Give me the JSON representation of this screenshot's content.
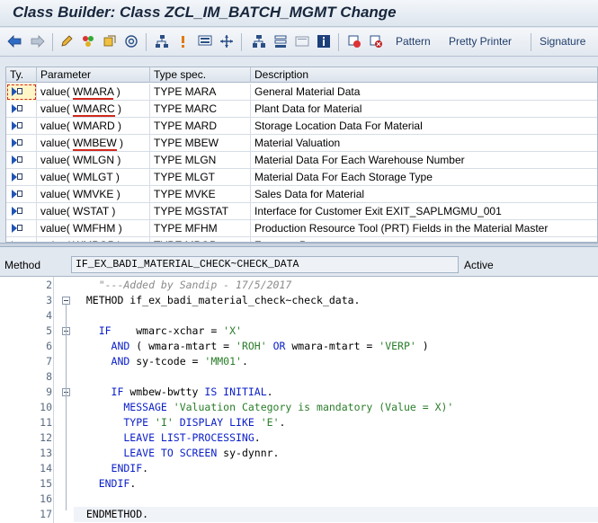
{
  "window": {
    "title": "Class Builder: Class ZCL_IM_BATCH_MGMT Change"
  },
  "toolbar": {
    "icons": [
      "back-arrow-icon",
      "forward-arrow-icon",
      "edit-pencil-icon",
      "activate-icon",
      "check-icon",
      "object-list-icon",
      "hierarchy-icon",
      "info-icon",
      "display-icon",
      "navigate-icon",
      "where-used-icon",
      "stack-icon",
      "layout-icon",
      "info-box-icon",
      "insert-icon",
      "cut-icon"
    ],
    "pattern_label": "Pattern",
    "pretty_printer_label": "Pretty Printer",
    "signature_label": "Signature"
  },
  "params": {
    "headers": {
      "type": "Ty.",
      "param": "Parameter",
      "spec": "Type spec.",
      "desc": "Description"
    },
    "rows": [
      {
        "kw": "value(",
        "name": "WMARA",
        "close": ")",
        "spec": "TYPE MARA",
        "desc": "General Material Data"
      },
      {
        "kw": "value(",
        "name": "WMARC",
        "close": ")",
        "spec": "TYPE MARC",
        "desc": "Plant Data for Material"
      },
      {
        "kw": "value(",
        "name": "WMARD",
        "close": ")",
        "spec": "TYPE MARD",
        "desc": "Storage Location Data For Material"
      },
      {
        "kw": "value(",
        "name": "WMBEW",
        "close": ")",
        "spec": "TYPE MBEW",
        "desc": "Material Valuation"
      },
      {
        "kw": "value(",
        "name": "WMLGN",
        "close": ")",
        "spec": "TYPE MLGN",
        "desc": "Material Data For Each Warehouse Number"
      },
      {
        "kw": "value(",
        "name": "WMLGT",
        "close": ")",
        "spec": "TYPE MLGT",
        "desc": "Material Data For Each Storage Type"
      },
      {
        "kw": "value(",
        "name": "WMVKE",
        "close": ")",
        "spec": "TYPE MVKE",
        "desc": "Sales Data for Material"
      },
      {
        "kw": "value(",
        "name": "WSTAT",
        "close": ")",
        "spec": "TYPE MGSTAT",
        "desc": "Interface for Customer Exit EXIT_SAPLMGMU_001"
      },
      {
        "kw": "value(",
        "name": "WMFHM",
        "close": ")",
        "spec": "TYPE MFHM",
        "desc": "Production Resource Tool (PRT) Fields in the Material Master"
      },
      {
        "kw": "value(",
        "name": "WMPOP",
        "close": ")",
        "spec": "TYPE MPOP",
        "desc": "Forecast Parameters"
      }
    ]
  },
  "method": {
    "label": "Method",
    "name": "IF_EX_BADI_MATERIAL_CHECK~CHECK_DATA",
    "status": "Active"
  },
  "editor": {
    "lines": [
      {
        "n": "2",
        "parts": [
          [
            "cmt",
            "    \"---Added by Sandip - 17/5/2017"
          ]
        ]
      },
      {
        "n": "3",
        "parts": [
          [
            "tx",
            "  METHOD if_ex_badi_material_check~check_data."
          ]
        ]
      },
      {
        "n": "4",
        "parts": [
          [
            "tx",
            ""
          ]
        ]
      },
      {
        "n": "5",
        "parts": [
          [
            "kw",
            "    IF"
          ],
          [
            "tx",
            "    wmarc-xchar = "
          ],
          [
            "str",
            "'X'"
          ]
        ]
      },
      {
        "n": "6",
        "parts": [
          [
            "kw",
            "      AND"
          ],
          [
            "tx",
            " ( wmara-mtart = "
          ],
          [
            "str",
            "'ROH'"
          ],
          [
            "kw",
            " OR"
          ],
          [
            "tx",
            " wmara-mtart = "
          ],
          [
            "str",
            "'VERP'"
          ],
          [
            "tx",
            " )"
          ]
        ]
      },
      {
        "n": "7",
        "parts": [
          [
            "kw",
            "      AND"
          ],
          [
            "tx",
            " sy-tcode = "
          ],
          [
            "str",
            "'MM01'"
          ],
          [
            "tx",
            "."
          ]
        ]
      },
      {
        "n": "8",
        "parts": [
          [
            "tx",
            ""
          ]
        ]
      },
      {
        "n": "9",
        "parts": [
          [
            "kw",
            "      IF"
          ],
          [
            "tx",
            " wmbew-bwtty "
          ],
          [
            "kw",
            "IS INITIAL"
          ],
          [
            "tx",
            "."
          ]
        ]
      },
      {
        "n": "10",
        "parts": [
          [
            "kw",
            "        MESSAGE"
          ],
          [
            "str",
            " 'Valuation Category is mandatory (Value = X)'"
          ]
        ]
      },
      {
        "n": "11",
        "parts": [
          [
            "kw",
            "        TYPE"
          ],
          [
            "str",
            " 'I'"
          ],
          [
            "kw",
            " DISPLAY LIKE"
          ],
          [
            "str",
            " 'E'"
          ],
          [
            "tx",
            "."
          ]
        ]
      },
      {
        "n": "12",
        "parts": [
          [
            "kw",
            "        LEAVE LIST-PROCESSING"
          ],
          [
            "tx",
            "."
          ]
        ]
      },
      {
        "n": "13",
        "parts": [
          [
            "kw",
            "        LEAVE TO SCREEN"
          ],
          [
            "tx",
            " sy-dynnr."
          ]
        ]
      },
      {
        "n": "14",
        "parts": [
          [
            "kw",
            "      ENDIF"
          ],
          [
            "tx",
            "."
          ]
        ]
      },
      {
        "n": "15",
        "parts": [
          [
            "kw",
            "    ENDIF"
          ],
          [
            "tx",
            "."
          ]
        ]
      },
      {
        "n": "16",
        "parts": [
          [
            "tx",
            ""
          ]
        ]
      },
      {
        "n": "17",
        "parts": [
          [
            "tx",
            "  ENDMETHOD."
          ]
        ]
      }
    ]
  }
}
